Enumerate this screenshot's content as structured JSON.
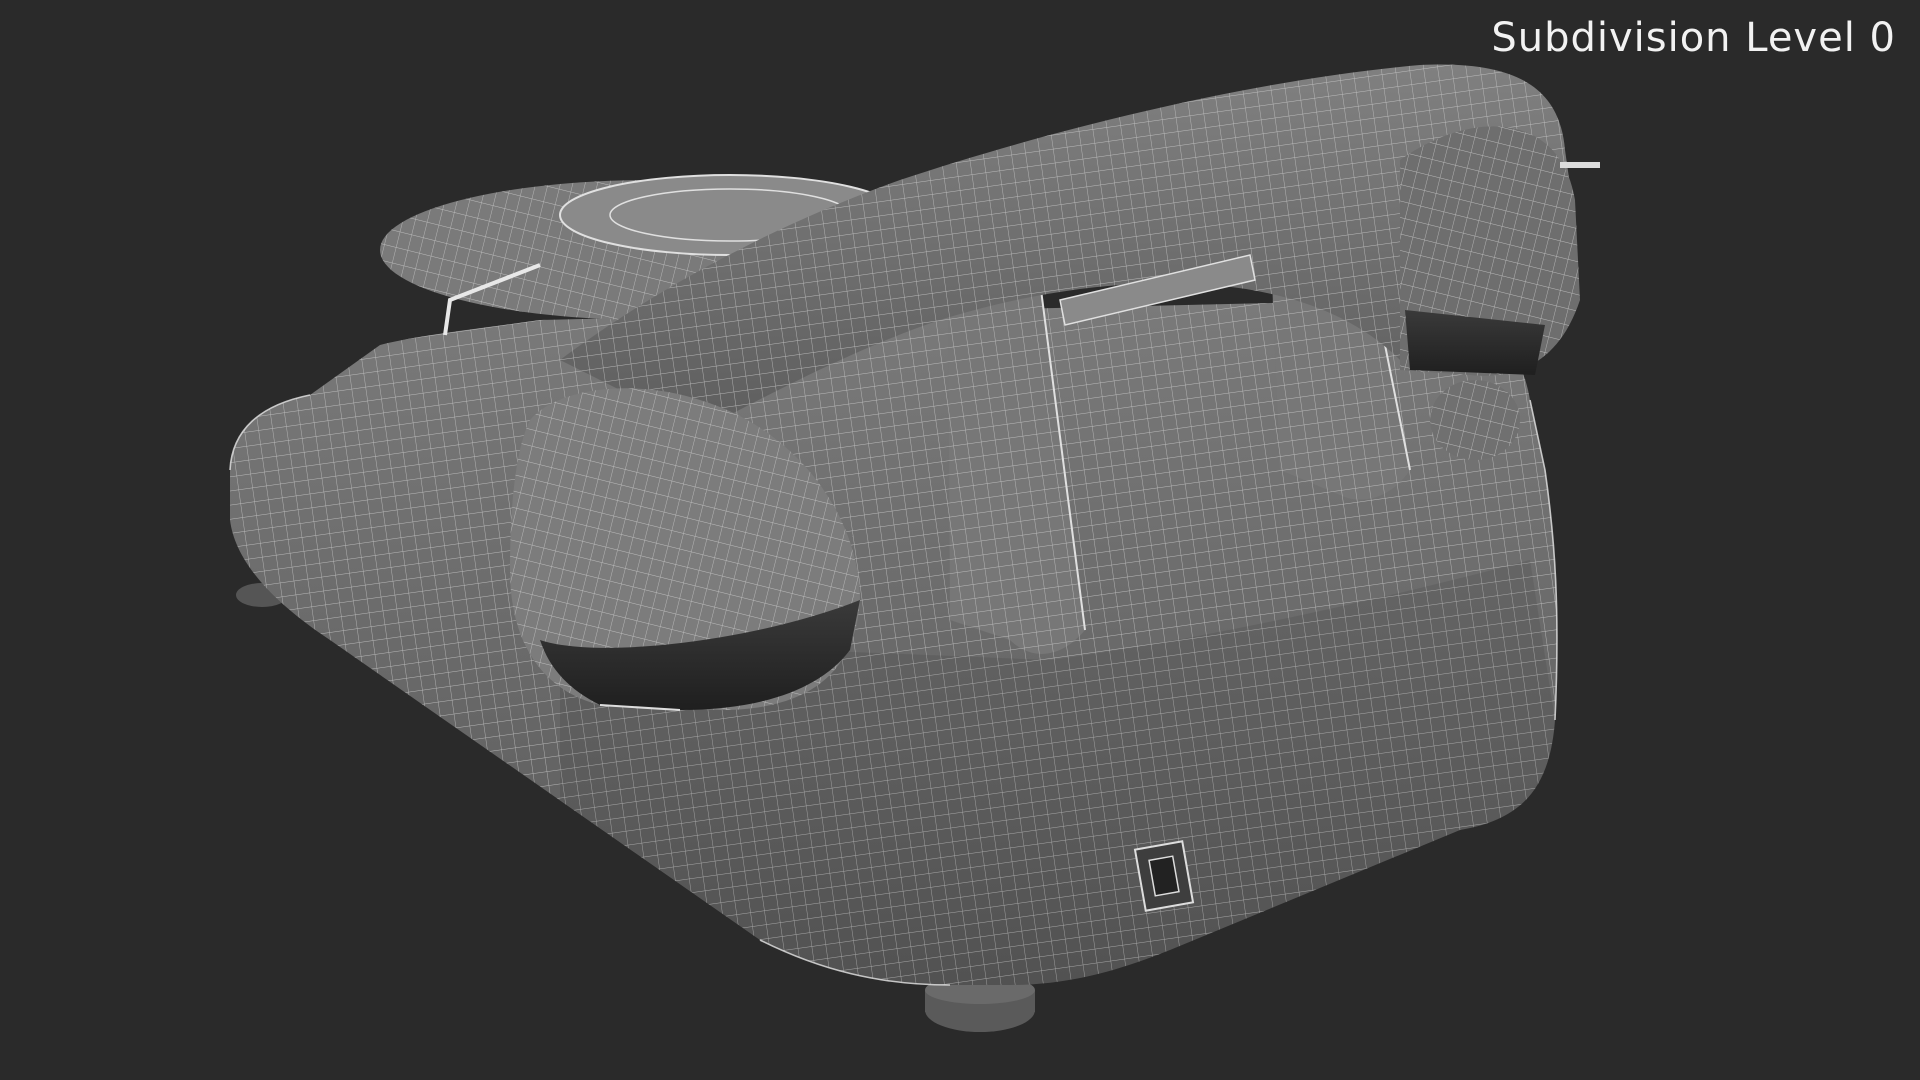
{
  "overlay": {
    "label": "Subdivision Level 0"
  },
  "scene": {
    "subject": "telephone-wireframe",
    "background_color": "#2a2a2a",
    "mesh_color": "#6a6a6a",
    "wire_color": "#cfcfcf"
  }
}
